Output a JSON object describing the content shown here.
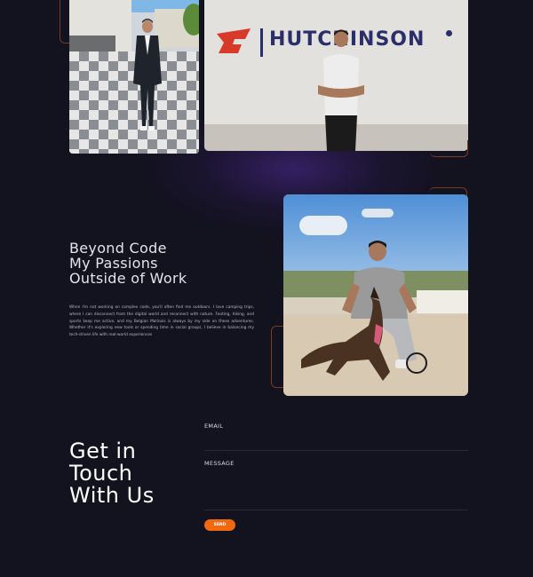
{
  "hero": {
    "hutchinson_sign": "HUTCHINSON"
  },
  "passions": {
    "title_lines": [
      "Beyond Code",
      "My Passions",
      "Outside of Work"
    ],
    "body": "When I'm not working on complex code, you'll often find me outdoors. I love camping trips, where I can disconnect from the digital world and reconnect with nature. Footing, hiking, and sports keep me active, and my Belgian Malinois is always by my side on these adventures. Whether it's exploring new tools or spending time in social groups, I believe in balancing my tech-driven life with real-world experiences"
  },
  "contact": {
    "title_lines": [
      "Get in",
      "Touch",
      "With Us"
    ],
    "email_label": "EMAIL",
    "message_label": "MESSAGE",
    "send_label": "SEND"
  },
  "colors": {
    "background": "#13121f",
    "accent": "#f0690f",
    "sign_navy": "#2a2f6b",
    "sign_red": "#d83a2a"
  }
}
